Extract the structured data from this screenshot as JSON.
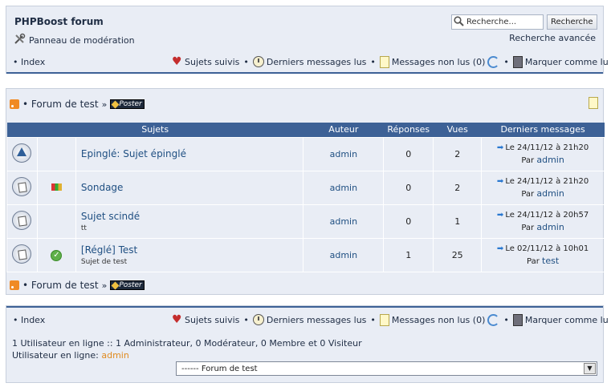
{
  "header": {
    "forum_title": "PHPBoost forum",
    "mod_panel": "Panneau de modération",
    "search_placeholder": "Recherche...",
    "search_button": "Recherche",
    "advanced_search": "Recherche avancée"
  },
  "nav": {
    "index": "• Index",
    "followed": "Sujets suivis",
    "last_read": "Derniers messages lus",
    "unread": "Messages non lus (0)",
    "mark_read": "Marquer comme lu",
    "sep": "•"
  },
  "forum": {
    "title": "• Forum de test",
    "raquo": "»",
    "poster_label": "Poster",
    "columns": [
      "Sujets",
      "Auteur",
      "Réponses",
      "Vues",
      "Derniers messages"
    ],
    "topics": [
      {
        "icon": "pinned-topic-icon",
        "status": "",
        "title": "Epinglé: Sujet épinglé",
        "subtitle": "",
        "author": "admin",
        "replies": "0",
        "views": "2",
        "last_date": "Le 24/11/12 à 21h20",
        "last_by": "Par",
        "last_user": "admin"
      },
      {
        "icon": "topic-icon",
        "status": "poll",
        "title": "Sondage",
        "subtitle": "",
        "author": "admin",
        "replies": "0",
        "views": "2",
        "last_date": "Le 24/11/12 à 21h20",
        "last_by": "Par",
        "last_user": "admin"
      },
      {
        "icon": "topic-icon",
        "status": "",
        "title": "Sujet scindé",
        "subtitle": "tt",
        "author": "admin",
        "replies": "0",
        "views": "1",
        "last_date": "Le 24/11/12 à 20h57",
        "last_by": "Par",
        "last_user": "admin"
      },
      {
        "icon": "topic-icon",
        "status": "solved",
        "title": "[Réglé] Test",
        "subtitle": "Sujet de test",
        "author": "admin",
        "replies": "1",
        "views": "25",
        "last_date": "Le 02/11/12 à 10h01",
        "last_by": "Par",
        "last_user": "test"
      }
    ]
  },
  "footer": {
    "online_summary": "1 Utilisateur en ligne :: 1 Administrateur, 0 Modérateur, 0 Membre et 0 Visiteur",
    "online_label": "Utilisateur en ligne:",
    "online_user": "admin",
    "select_value": "------ Forum de test"
  },
  "colors": {
    "accent": "#3d6196",
    "panel": "#e9edf5",
    "link": "#1f4f82",
    "online_user": "#e08a1e"
  }
}
